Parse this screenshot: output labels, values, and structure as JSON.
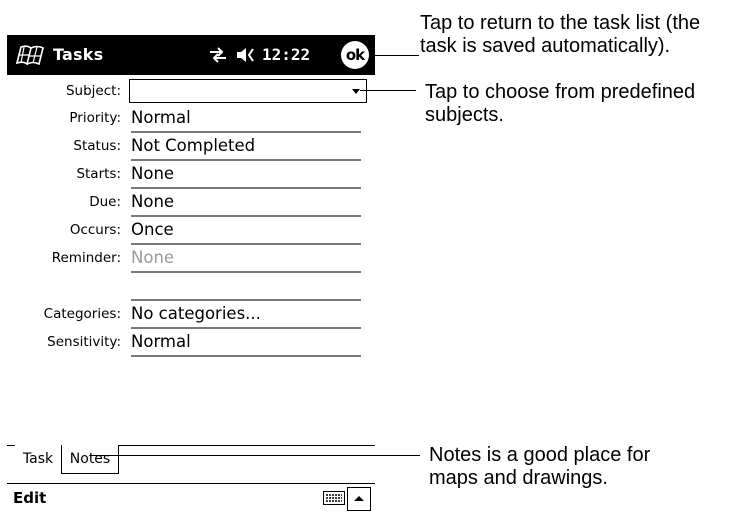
{
  "titlebar": {
    "app_name": "Tasks",
    "clock": "12:22",
    "ok_label": "ok"
  },
  "form": {
    "subject": {
      "label": "Subject:",
      "value": ""
    },
    "rows": [
      {
        "label": "Priority:",
        "value": "Normal"
      },
      {
        "label": "Status:",
        "value": "Not Completed"
      },
      {
        "label": "Starts:",
        "value": "None"
      },
      {
        "label": "Due:",
        "value": "None"
      },
      {
        "label": "Occurs:",
        "value": "Once"
      },
      {
        "label": "Reminder:",
        "value": "None"
      },
      {
        "label": "Categories:",
        "value": "No categories..."
      },
      {
        "label": "Sensitivity:",
        "value": "Normal"
      }
    ]
  },
  "tabs": [
    {
      "label": "Task"
    },
    {
      "label": "Notes"
    }
  ],
  "menubar": {
    "edit_label": "Edit"
  },
  "callouts": {
    "ok": "Tap to return to the task list (the\ntask is saved automatically).",
    "subject": "Tap to choose from predefined\nsubjects.",
    "notes": "Notes is a good place for\nmaps and drawings."
  }
}
